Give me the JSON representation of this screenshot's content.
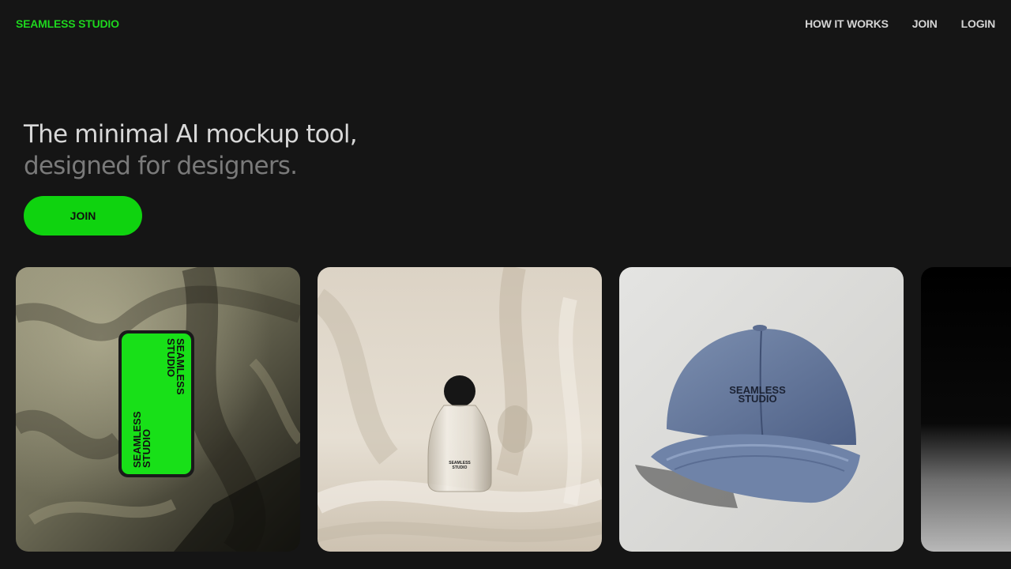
{
  "nav": {
    "brand": "SEAMLESS STUDIO",
    "links": [
      {
        "label": "HOW IT WORKS"
      },
      {
        "label": "JOIN"
      },
      {
        "label": "LOGIN"
      }
    ]
  },
  "hero": {
    "headline_line1": "The minimal AI mockup tool,",
    "headline_line2": "designed for designers.",
    "cta_label": "JOIN"
  },
  "gallery": {
    "cards": [
      {
        "subject": "phone on linen fabric",
        "label_a": "SEAMLESS",
        "label_b": "STUDIO"
      },
      {
        "subject": "perfume bottle on cream silk",
        "label_a": "SEAMLESS",
        "label_b": "STUDIO"
      },
      {
        "subject": "blue cap on grey background",
        "label_a": "SEAMLESS",
        "label_b": "STUDIO"
      },
      {
        "subject": "dark gradient card"
      }
    ]
  },
  "colors": {
    "background": "#151515",
    "accent": "#0fd30f",
    "brand_text": "#1ed61e",
    "headline_primary": "#d8d8d8",
    "headline_secondary": "#7a7a7a"
  }
}
